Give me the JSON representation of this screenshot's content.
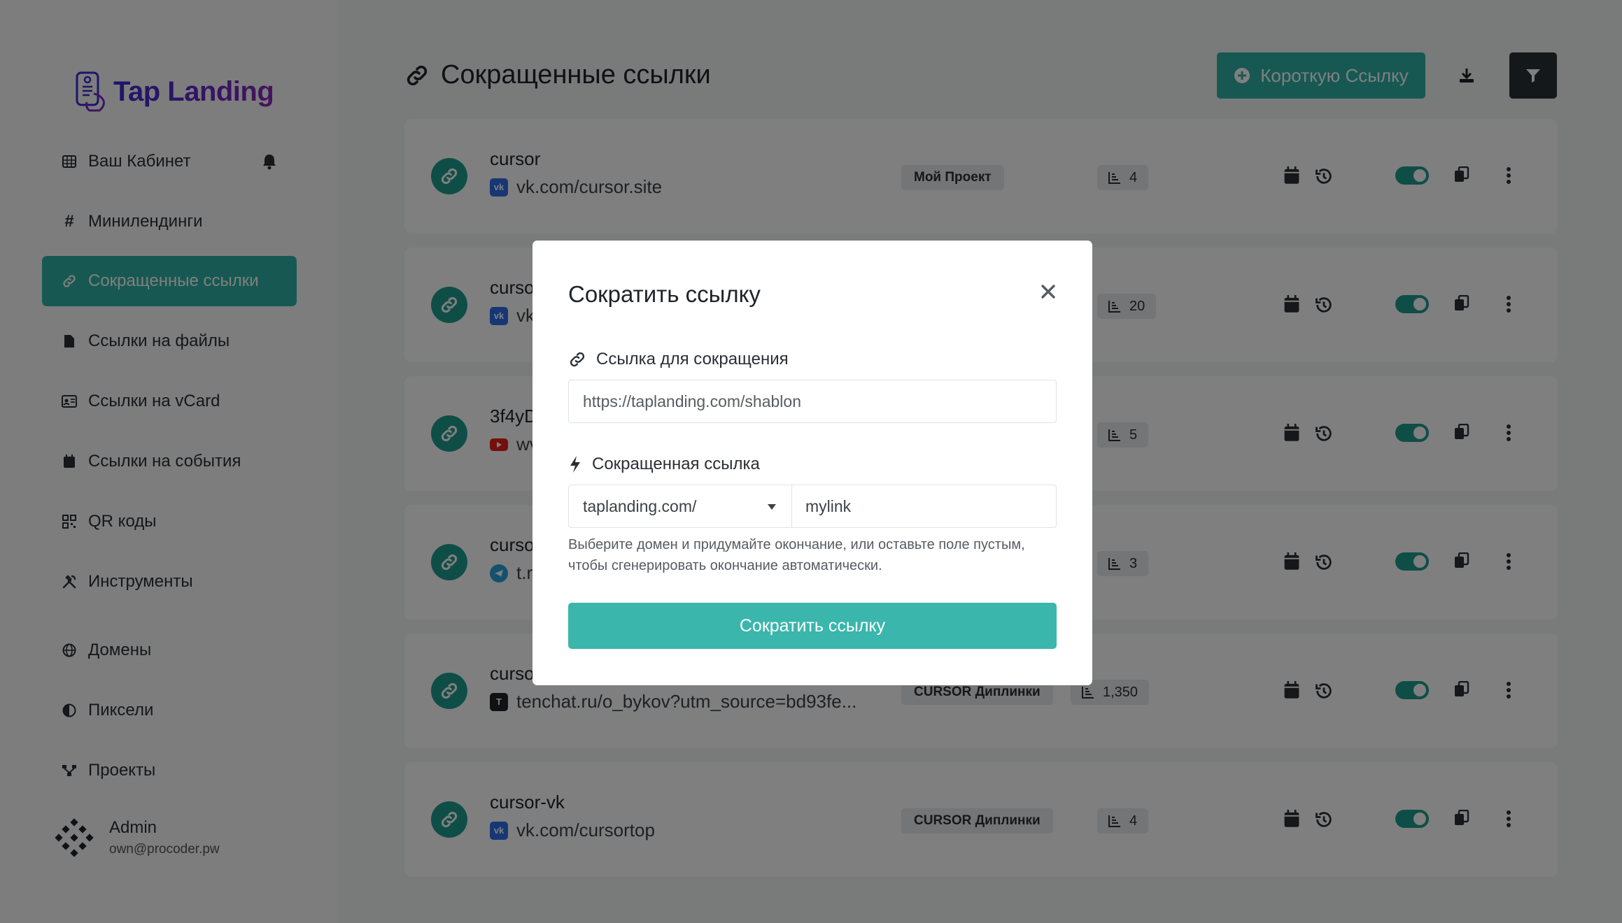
{
  "app": {
    "logo_text": "Tap Landing",
    "page_title": "Сокращенные ссылки"
  },
  "colors": {
    "accent": "#2fb3a5",
    "accent_dark": "#1f9d8f",
    "submit": "#3ab6ac",
    "dark_button": "#2b3035"
  },
  "sidebar": {
    "items": [
      {
        "label": "Ваш Кабинет",
        "icon": "grid-icon"
      },
      {
        "label": "Минилендинги",
        "icon": "hash-icon"
      },
      {
        "label": "Сокращенные ссылки",
        "icon": "link-icon",
        "active": true
      },
      {
        "label": "Ссылки на файлы",
        "icon": "file-icon"
      },
      {
        "label": "Ссылки на vCard",
        "icon": "id-card-icon"
      },
      {
        "label": "Ссылки на события",
        "icon": "calendar-icon"
      },
      {
        "label": "QR коды",
        "icon": "qr-icon"
      },
      {
        "label": "Инструменты",
        "icon": "tools-icon"
      },
      {
        "label": "Домены",
        "icon": "globe-icon"
      },
      {
        "label": "Пиксели",
        "icon": "half-circle-icon"
      },
      {
        "label": "Проекты",
        "icon": "project-icon"
      }
    ],
    "user": {
      "name": "Admin",
      "email": "own@procoder.pw"
    }
  },
  "header": {
    "new_button_label": "Короткую Ссылку"
  },
  "links": [
    {
      "name": "cursor",
      "url": "vk.com/cursor.site",
      "service": "vk",
      "project": "Мой Проект",
      "clicks": "4"
    },
    {
      "name": "curso",
      "url": "vk",
      "service": "vk",
      "project": "",
      "clicks": "20"
    },
    {
      "name": "3f4yD",
      "url": "wv",
      "service": "yt",
      "project": "",
      "clicks": "5"
    },
    {
      "name": "curso",
      "url": "t.r",
      "service": "tg",
      "project": "",
      "clicks": "3"
    },
    {
      "name": "curso",
      "url": "tenchat.ru/o_bykov?utm_source=bd93fe...",
      "service": "tc",
      "project": "CURSOR Диплинки",
      "clicks": "1,350"
    },
    {
      "name": "cursor-vk",
      "url": "vk.com/cursortop",
      "service": "vk",
      "project": "CURSOR Диплинки",
      "clicks": "4"
    }
  ],
  "modal": {
    "title": "Сократить ссылку",
    "url_label": "Ссылка для сокращения",
    "url_placeholder": "https://taplanding.com/shablon",
    "short_label": "Сокращенная ссылка",
    "domain_selected": "taplanding.com/",
    "alias_placeholder": "mylink",
    "help_text": "Выберите домен и придумайте окончание, или оставьте поле пустым, чтобы сгенерировать окончание автоматически.",
    "submit_label": "Сократить ссылку"
  }
}
